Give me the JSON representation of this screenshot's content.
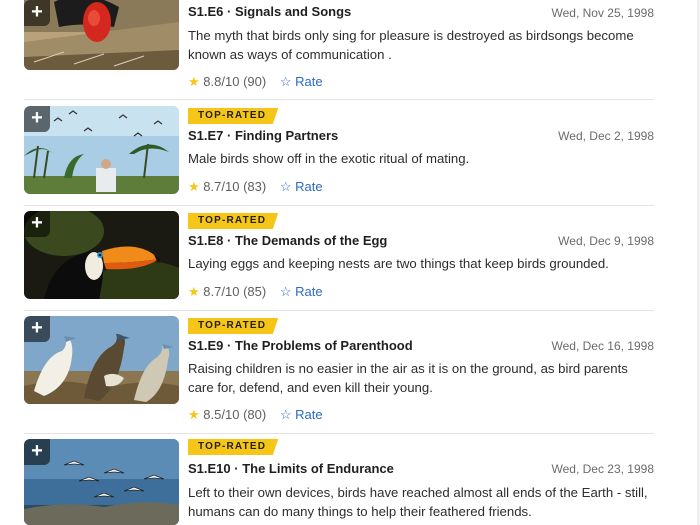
{
  "episodes": [
    {
      "code": "S1.E6 · Signals and Songs",
      "badge": "",
      "date": "Wed, Nov 25, 1998",
      "description": "The myth that birds only sing for pleasure is destroyed as birdsongs become known as ways of communication .",
      "rating": "8.8/10",
      "votes": "(90)",
      "rate_label": "Rate",
      "thumbnail": "frigatebird-red-pouch"
    },
    {
      "code": "S1.E7 · Finding Partners",
      "badge": "TOP-RATED",
      "date": "Wed, Dec 2, 1998",
      "description": "Male birds show off in the exotic ritual of mating.",
      "rating": "8.7/10",
      "votes": "(83)",
      "rate_label": "Rate",
      "thumbnail": "palms-and-birds"
    },
    {
      "code": "S1.E8 · The Demands of the Egg",
      "badge": "TOP-RATED",
      "date": "Wed, Dec 9, 1998",
      "description": "Laying eggs and keeping nests are two things that keep birds grounded.",
      "rating": "8.7/10",
      "votes": "(85)",
      "rate_label": "Rate",
      "thumbnail": "toucan"
    },
    {
      "code": "S1.E9 · The Problems of Parenthood",
      "badge": "TOP-RATED",
      "date": "Wed, Dec 16, 1998",
      "description": "Raising children is no easier in the air as it is on the ground, as bird parents care for, defend, and even kill their young.",
      "rating": "8.5/10",
      "votes": "(80)",
      "rate_label": "Rate",
      "thumbnail": "boobies-colony"
    },
    {
      "code": "S1.E10 · The Limits of Endurance",
      "badge": "TOP-RATED",
      "date": "Wed, Dec 23, 1998",
      "description": "Left to their own devices, birds have reached almost all ends of the Earth - still, humans can do many things to help their feathered friends.",
      "rating": "",
      "votes": "",
      "rate_label": "",
      "thumbnail": "flying-flock"
    }
  ],
  "colors": {
    "badge": "#f5c518",
    "link": "#2a6ac8",
    "star": "#f5c518"
  },
  "icons": {
    "add": "plus-icon",
    "star": "star-icon",
    "rate": "star-outline-icon"
  }
}
